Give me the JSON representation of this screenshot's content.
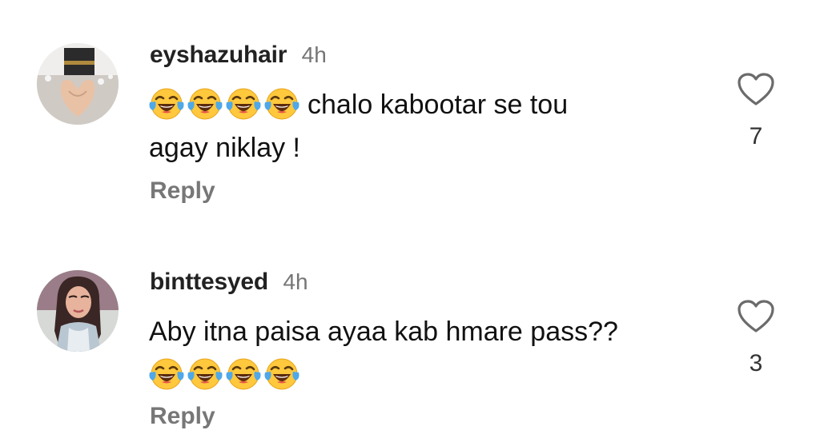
{
  "comments": [
    {
      "username": "eyshazuhair",
      "time": "4h",
      "text_line1": "chalo kabootar se tou",
      "text_line2": "agay niklay !",
      "emoji_name": "face-with-tears-of-joy-icon",
      "emoji_count": 4,
      "likes": "7",
      "reply_label": "Reply"
    },
    {
      "username": "binttesyed",
      "time": "4h",
      "text_line1": "Aby itna paisa ayaa kab hmare pass??",
      "emoji_name": "face-with-tears-of-joy-icon",
      "emoji_count": 4,
      "likes": "3",
      "reply_label": "Reply"
    }
  ],
  "colors": {
    "username": "#222222",
    "time": "#757575",
    "reply": "#777777",
    "emoji_face": "#FFC83D",
    "tears": "#4FA8E8"
  }
}
